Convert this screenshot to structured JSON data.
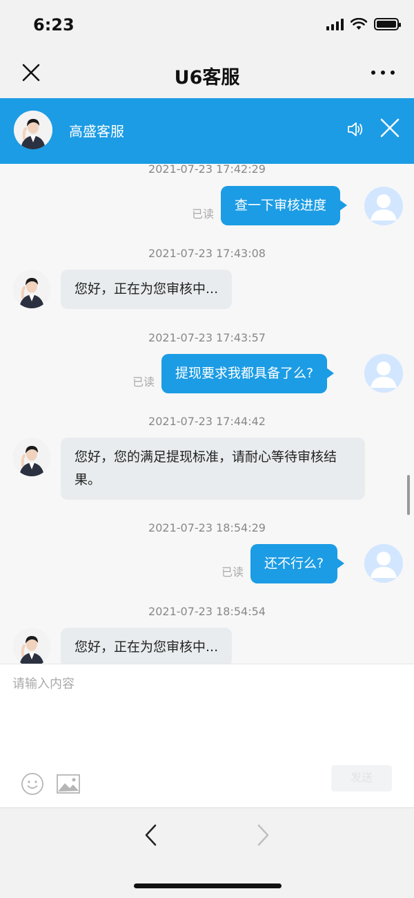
{
  "status_bar": {
    "time": "6:23"
  },
  "nav": {
    "title": "U6客服"
  },
  "agent": {
    "name": "高盛客服"
  },
  "messages": [
    {
      "time": "2021-07-23 17:42:29",
      "side": "out",
      "text": "查一下审核进度",
      "status": "已读"
    },
    {
      "time": "2021-07-23 17:43:08",
      "side": "in",
      "text": "您好，正在为您审核中..."
    },
    {
      "time": "2021-07-23 17:43:57",
      "side": "out",
      "text": "提现要求我都具备了么?",
      "status": "已读"
    },
    {
      "time": "2021-07-23 17:44:42",
      "side": "in",
      "text": "您好，您的满足提现标准，请耐心等待审核结果。"
    },
    {
      "time": "2021-07-23 18:54:29",
      "side": "out",
      "text": "还不行么?",
      "status": "已读"
    },
    {
      "time": "2021-07-23 18:54:54",
      "side": "in",
      "text": "您好，正在为您审核中..."
    }
  ],
  "input": {
    "placeholder": "请输入内容",
    "send_label": "发送"
  },
  "colors": {
    "accent": "#1c9ce4",
    "incoming_bubble": "#e9ecee",
    "background": "#f7f7f7"
  },
  "icons": [
    "close-icon",
    "more-icon",
    "speaker-icon",
    "emoji-icon",
    "image-icon",
    "back-icon",
    "forward-icon",
    "signal-icon",
    "wifi-icon",
    "battery-icon"
  ]
}
